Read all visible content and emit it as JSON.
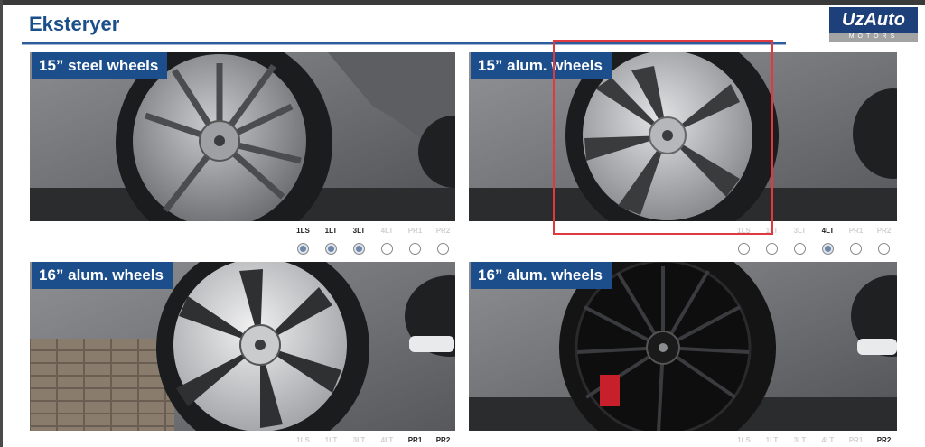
{
  "header": {
    "title": "Eksteryer",
    "logo_main": "UzAuto",
    "logo_sub": "MOTORS"
  },
  "colors": {
    "accent": "#1d4e8c",
    "highlight_box": "#e0393e"
  },
  "panels": [
    {
      "label": "15” steel wheels",
      "wheel": "silver-steel-icon",
      "trims": [
        {
          "name": "1LS",
          "on": true
        },
        {
          "name": "1LT",
          "on": true
        },
        {
          "name": "3LT",
          "on": true
        },
        {
          "name": "4LT",
          "on": false
        },
        {
          "name": "PR1",
          "on": false
        },
        {
          "name": "PR2",
          "on": false
        }
      ]
    },
    {
      "label": "15” alum. wheels",
      "wheel": "silver-alloy-icon",
      "trims": [
        {
          "name": "1LS",
          "on": false
        },
        {
          "name": "1LT",
          "on": false
        },
        {
          "name": "3LT",
          "on": false
        },
        {
          "name": "4LT",
          "on": true
        },
        {
          "name": "PR1",
          "on": false
        },
        {
          "name": "PR2",
          "on": false
        }
      ]
    },
    {
      "label": "16” alum. wheels",
      "wheel": "bright-alloy-icon",
      "trims": [
        {
          "name": "1LS",
          "on": false
        },
        {
          "name": "1LT",
          "on": false
        },
        {
          "name": "3LT",
          "on": false
        },
        {
          "name": "4LT",
          "on": false
        },
        {
          "name": "PR1",
          "on": true
        },
        {
          "name": "PR2",
          "on": true
        }
      ]
    },
    {
      "label": "16” alum. wheels",
      "wheel": "black-alloy-icon",
      "trims": [
        {
          "name": "1LS",
          "on": false
        },
        {
          "name": "1LT",
          "on": false
        },
        {
          "name": "3LT",
          "on": false
        },
        {
          "name": "4LT",
          "on": false
        },
        {
          "name": "PR1",
          "on": false
        },
        {
          "name": "PR2",
          "on": true
        }
      ]
    }
  ]
}
